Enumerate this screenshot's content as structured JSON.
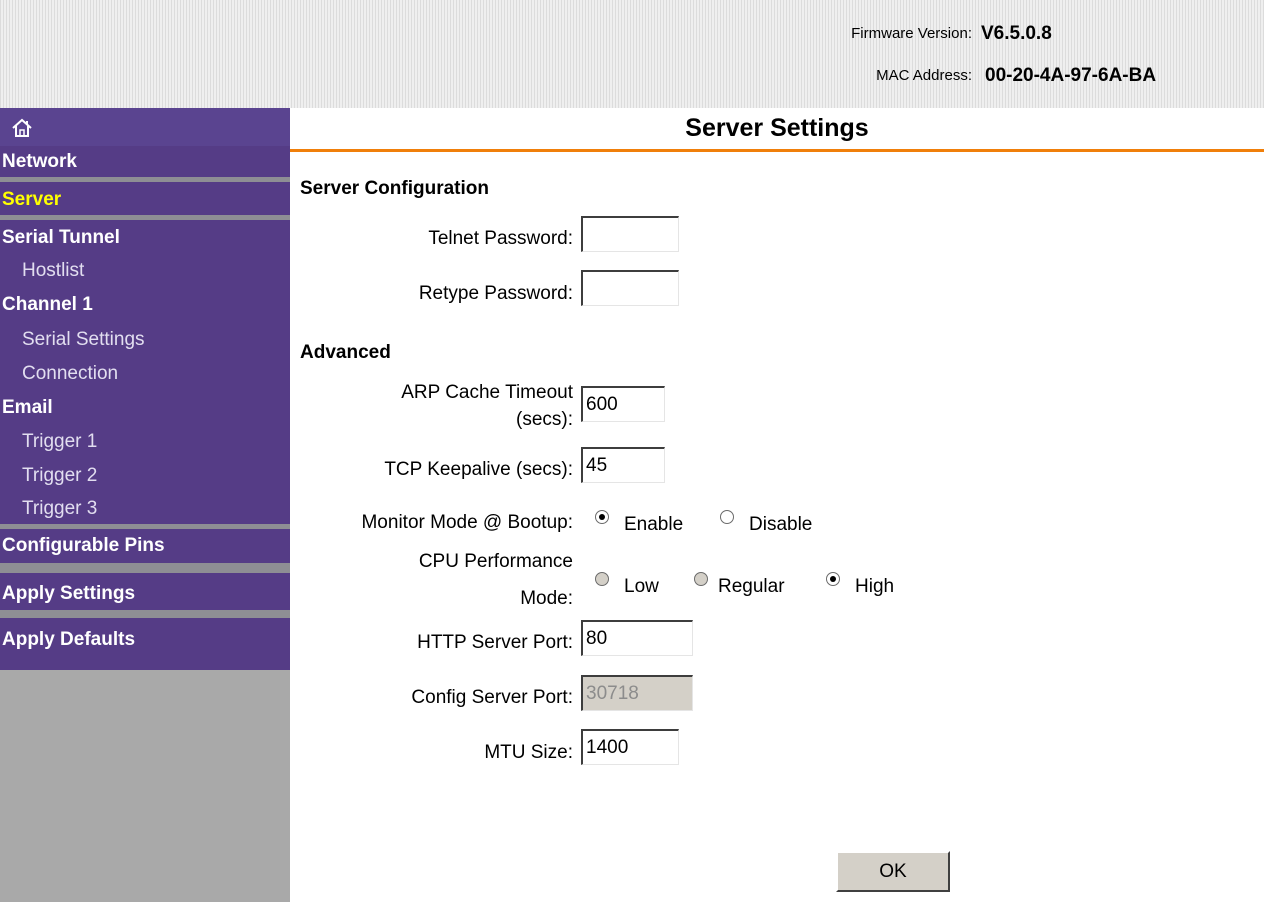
{
  "header": {
    "firmware_label": "Firmware Version:",
    "firmware_value": "V6.5.0.8",
    "mac_label": "MAC Address:",
    "mac_value": "00-20-4A-97-6A-BA"
  },
  "sidebar": {
    "home_icon": "home-icon",
    "items": [
      {
        "label": "Network"
      },
      {
        "label": "Server"
      },
      {
        "label": "Serial Tunnel"
      },
      {
        "label": "Hostlist"
      },
      {
        "label": "Channel 1"
      },
      {
        "label": "Serial Settings"
      },
      {
        "label": "Connection"
      },
      {
        "label": "Email"
      },
      {
        "label": "Trigger 1"
      },
      {
        "label": "Trigger 2"
      },
      {
        "label": "Trigger 3"
      },
      {
        "label": "Configurable Pins"
      },
      {
        "label": "Apply Settings"
      },
      {
        "label": "Apply Defaults"
      }
    ],
    "active_item": "Server"
  },
  "page": {
    "title": "Server Settings"
  },
  "server_config": {
    "heading": "Server Configuration",
    "telnet_password_label": "Telnet Password:",
    "telnet_password_value": "",
    "retype_password_label": "Retype Password:",
    "retype_password_value": ""
  },
  "advanced": {
    "heading": "Advanced",
    "arp_label_line1": "ARP Cache Timeout",
    "arp_label_line2": "(secs):",
    "arp_value": "600",
    "tcp_label": "TCP Keepalive (secs):",
    "tcp_value": "45",
    "monitor_label": "Monitor Mode @ Bootup:",
    "monitor_options": [
      "Enable",
      "Disable"
    ],
    "monitor_selected": "Enable",
    "cpu_label_line1": "CPU Performance",
    "cpu_label_line2": "Mode:",
    "cpu_options": [
      "Low",
      "Regular",
      "High"
    ],
    "cpu_selected": "High",
    "http_label": "HTTP Server Port:",
    "http_value": "80",
    "config_label": "Config Server Port:",
    "config_value": "30718",
    "mtu_label": "MTU Size:",
    "mtu_value": "1400"
  },
  "buttons": {
    "ok_label": "OK"
  },
  "colors": {
    "sidebar_purple": "#553c86",
    "active_nav": "#ffff00",
    "title_underline": "#f07f0a",
    "sidebar_grey": "#a9a9a9"
  }
}
